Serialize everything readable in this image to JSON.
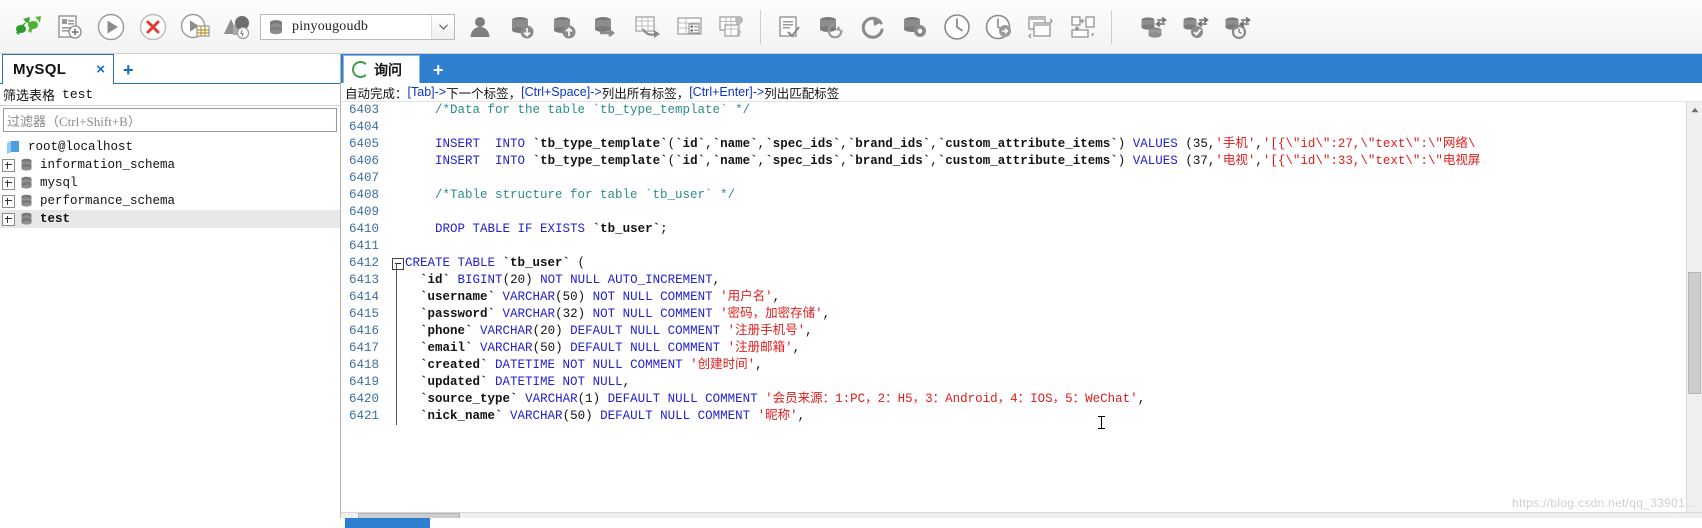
{
  "toolbar": {
    "icons": [
      {
        "name": "connect-icon",
        "title": "Connect"
      },
      {
        "name": "new-query-icon",
        "title": "New Query"
      },
      {
        "name": "execute-icon",
        "title": "Execute"
      },
      {
        "name": "stop-icon",
        "title": "Stop"
      },
      {
        "name": "execute-to-grid-icon",
        "title": "Execute to Grid"
      },
      {
        "name": "explain-plan-icon",
        "title": "Explain Plan"
      }
    ],
    "db_selector": {
      "name": "pinyougoudb",
      "icon": "database-icon",
      "arrow": "chevron-down-icon"
    },
    "icons_group2": [
      {
        "name": "user-manager-icon",
        "title": "User Manager"
      },
      {
        "name": "backup-database-icon",
        "title": "Backup Database"
      },
      {
        "name": "restore-database-icon",
        "title": "Restore Database"
      },
      {
        "name": "transfer-database-icon",
        "title": "Transfer Database"
      },
      {
        "name": "export-table-icon",
        "title": "Export Table"
      },
      {
        "name": "table-data-icon",
        "title": "Table Data"
      },
      {
        "name": "table-design-icon",
        "title": "Table Design"
      }
    ],
    "icons_group3": [
      {
        "name": "query-builder-icon",
        "title": "Query Builder"
      },
      {
        "name": "refresh-database-icon",
        "title": "Refresh Database"
      },
      {
        "name": "refresh-icon",
        "title": "Refresh"
      },
      {
        "name": "database-settings-icon",
        "title": "Database Settings"
      },
      {
        "name": "history-icon",
        "title": "History"
      },
      {
        "name": "scheduled-job-icon",
        "title": "Scheduled Job"
      },
      {
        "name": "window-tile-icon",
        "title": "Tile Windows"
      },
      {
        "name": "window-arrange-icon",
        "title": "Arrange Windows"
      }
    ],
    "icons_group4": [
      {
        "name": "data-sync-icon",
        "title": "Data Synchronization"
      },
      {
        "name": "data-sync-check-icon",
        "title": "Structure Synchronization"
      },
      {
        "name": "data-sync-history-icon",
        "title": "Synchronization History"
      }
    ]
  },
  "sidebar": {
    "connection_tab": {
      "label": "MySQL",
      "close": "×"
    },
    "add_tab": "+",
    "filter": {
      "label": "筛选表格",
      "value": "test",
      "placeholder": "过滤器（Ctrl+Shift+B）"
    },
    "tree": [
      {
        "label": "root@localhost",
        "icon": "server-icon",
        "expandable": false,
        "bold": false,
        "selected": false,
        "indent": 0
      },
      {
        "label": "information_schema",
        "icon": "database-icon",
        "expandable": true,
        "bold": false,
        "selected": false,
        "indent": 1
      },
      {
        "label": "mysql",
        "icon": "database-icon",
        "expandable": true,
        "bold": false,
        "selected": false,
        "indent": 1
      },
      {
        "label": "performance_schema",
        "icon": "database-icon",
        "expandable": true,
        "bold": false,
        "selected": false,
        "indent": 1
      },
      {
        "label": "test",
        "icon": "database-icon",
        "expandable": true,
        "bold": true,
        "selected": true,
        "indent": 1
      }
    ]
  },
  "query_panel": {
    "tab": {
      "label": "询问",
      "icon": "query-spinner-icon"
    },
    "add_tab": "+",
    "hint": {
      "prefix": "自动完成：",
      "part1_key": "[Tab]->",
      "part1_text": " 下一个标签，",
      "part2_key": "[Ctrl+Space]->",
      "part2_text": " 列出所有标签，",
      "part3_key": "[Ctrl+Enter]->",
      "part3_text": " 列出匹配标签"
    },
    "first_line_number": 6403,
    "lines": [
      {
        "n": "6403",
        "fold": "none",
        "tokens": [
          {
            "t": "    ",
            "c": "plain"
          },
          {
            "t": "/*Data for the table `tb_type_template` */",
            "c": "cmt"
          }
        ]
      },
      {
        "n": "6404",
        "fold": "none",
        "tokens": []
      },
      {
        "n": "6405",
        "fold": "none",
        "tokens": [
          {
            "t": "    ",
            "c": "plain"
          },
          {
            "t": "INSERT",
            "c": "kw"
          },
          {
            "t": "  ",
            "c": "plain"
          },
          {
            "t": "INTO",
            "c": "kw"
          },
          {
            "t": " ",
            "c": "plain"
          },
          {
            "t": "`tb_type_template`",
            "c": "ident"
          },
          {
            "t": "(",
            "c": "pun"
          },
          {
            "t": "`id`",
            "c": "ident"
          },
          {
            "t": ",",
            "c": "pun"
          },
          {
            "t": "`name`",
            "c": "ident"
          },
          {
            "t": ",",
            "c": "pun"
          },
          {
            "t": "`spec_ids`",
            "c": "ident"
          },
          {
            "t": ",",
            "c": "pun"
          },
          {
            "t": "`brand_ids`",
            "c": "ident"
          },
          {
            "t": ",",
            "c": "pun"
          },
          {
            "t": "`custom_attribute_items`",
            "c": "ident"
          },
          {
            "t": ") ",
            "c": "pun"
          },
          {
            "t": "VALUES",
            "c": "kw"
          },
          {
            "t": " (35,",
            "c": "plain"
          },
          {
            "t": "'手机'",
            "c": "str"
          },
          {
            "t": ",",
            "c": "plain"
          },
          {
            "t": "'[{\\\"id\\\":27,\\\"text\\\":\\\"网络\\",
            "c": "str"
          }
        ]
      },
      {
        "n": "6406",
        "fold": "none",
        "tokens": [
          {
            "t": "    ",
            "c": "plain"
          },
          {
            "t": "INSERT",
            "c": "kw"
          },
          {
            "t": "  ",
            "c": "plain"
          },
          {
            "t": "INTO",
            "c": "kw"
          },
          {
            "t": " ",
            "c": "plain"
          },
          {
            "t": "`tb_type_template`",
            "c": "ident"
          },
          {
            "t": "(",
            "c": "pun"
          },
          {
            "t": "`id`",
            "c": "ident"
          },
          {
            "t": ",",
            "c": "pun"
          },
          {
            "t": "`name`",
            "c": "ident"
          },
          {
            "t": ",",
            "c": "pun"
          },
          {
            "t": "`spec_ids`",
            "c": "ident"
          },
          {
            "t": ",",
            "c": "pun"
          },
          {
            "t": "`brand_ids`",
            "c": "ident"
          },
          {
            "t": ",",
            "c": "pun"
          },
          {
            "t": "`custom_attribute_items`",
            "c": "ident"
          },
          {
            "t": ") ",
            "c": "pun"
          },
          {
            "t": "VALUES",
            "c": "kw"
          },
          {
            "t": " (37,",
            "c": "plain"
          },
          {
            "t": "'电视'",
            "c": "str"
          },
          {
            "t": ",",
            "c": "plain"
          },
          {
            "t": "'[{\\\"id\\\":33,\\\"text\\\":\\\"电视屏",
            "c": "str"
          }
        ]
      },
      {
        "n": "6407",
        "fold": "none",
        "tokens": []
      },
      {
        "n": "6408",
        "fold": "none",
        "tokens": [
          {
            "t": "    ",
            "c": "plain"
          },
          {
            "t": "/*Table structure for table `tb_user` */",
            "c": "cmt"
          }
        ]
      },
      {
        "n": "6409",
        "fold": "none",
        "tokens": []
      },
      {
        "n": "6410",
        "fold": "none",
        "tokens": [
          {
            "t": "    ",
            "c": "plain"
          },
          {
            "t": "DROP TABLE IF EXISTS",
            "c": "kw"
          },
          {
            "t": " ",
            "c": "plain"
          },
          {
            "t": "`tb_user`",
            "c": "ident"
          },
          {
            "t": ";",
            "c": "pun"
          }
        ]
      },
      {
        "n": "6411",
        "fold": "none",
        "tokens": []
      },
      {
        "n": "6412",
        "fold": "start",
        "tokens": [
          {
            "t": "CREATE TABLE",
            "c": "kw"
          },
          {
            "t": " ",
            "c": "plain"
          },
          {
            "t": "`tb_user`",
            "c": "ident"
          },
          {
            "t": " (",
            "c": "pun"
          }
        ]
      },
      {
        "n": "6413",
        "fold": "line",
        "tokens": [
          {
            "t": "  ",
            "c": "plain"
          },
          {
            "t": "`id`",
            "c": "ident"
          },
          {
            "t": " ",
            "c": "plain"
          },
          {
            "t": "BIGINT",
            "c": "kw"
          },
          {
            "t": "(20) ",
            "c": "plain"
          },
          {
            "t": "NOT NULL AUTO_INCREMENT",
            "c": "kw"
          },
          {
            "t": ",",
            "c": "pun"
          }
        ]
      },
      {
        "n": "6414",
        "fold": "line",
        "tokens": [
          {
            "t": "  ",
            "c": "plain"
          },
          {
            "t": "`username`",
            "c": "ident"
          },
          {
            "t": " ",
            "c": "plain"
          },
          {
            "t": "VARCHAR",
            "c": "kw"
          },
          {
            "t": "(50) ",
            "c": "plain"
          },
          {
            "t": "NOT NULL COMMENT",
            "c": "kw"
          },
          {
            "t": " ",
            "c": "plain"
          },
          {
            "t": "'用户名'",
            "c": "str"
          },
          {
            "t": ",",
            "c": "pun"
          }
        ]
      },
      {
        "n": "6415",
        "fold": "line",
        "tokens": [
          {
            "t": "  ",
            "c": "plain"
          },
          {
            "t": "`password`",
            "c": "ident"
          },
          {
            "t": " ",
            "c": "plain"
          },
          {
            "t": "VARCHAR",
            "c": "kw"
          },
          {
            "t": "(32) ",
            "c": "plain"
          },
          {
            "t": "NOT NULL COMMENT",
            "c": "kw"
          },
          {
            "t": " ",
            "c": "plain"
          },
          {
            "t": "'密码，加密存储'",
            "c": "str"
          },
          {
            "t": ",",
            "c": "pun"
          }
        ]
      },
      {
        "n": "6416",
        "fold": "line",
        "tokens": [
          {
            "t": "  ",
            "c": "plain"
          },
          {
            "t": "`phone`",
            "c": "ident"
          },
          {
            "t": " ",
            "c": "plain"
          },
          {
            "t": "VARCHAR",
            "c": "kw"
          },
          {
            "t": "(20) ",
            "c": "plain"
          },
          {
            "t": "DEFAULT NULL COMMENT",
            "c": "kw"
          },
          {
            "t": " ",
            "c": "plain"
          },
          {
            "t": "'注册手机号'",
            "c": "str"
          },
          {
            "t": ",",
            "c": "pun"
          }
        ]
      },
      {
        "n": "6417",
        "fold": "line",
        "tokens": [
          {
            "t": "  ",
            "c": "plain"
          },
          {
            "t": "`email`",
            "c": "ident"
          },
          {
            "t": " ",
            "c": "plain"
          },
          {
            "t": "VARCHAR",
            "c": "kw"
          },
          {
            "t": "(50) ",
            "c": "plain"
          },
          {
            "t": "DEFAULT NULL COMMENT",
            "c": "kw"
          },
          {
            "t": " ",
            "c": "plain"
          },
          {
            "t": "'注册邮箱'",
            "c": "str"
          },
          {
            "t": ",",
            "c": "pun"
          }
        ]
      },
      {
        "n": "6418",
        "fold": "line",
        "tokens": [
          {
            "t": "  ",
            "c": "plain"
          },
          {
            "t": "`created`",
            "c": "ident"
          },
          {
            "t": " ",
            "c": "plain"
          },
          {
            "t": "DATETIME NOT NULL COMMENT",
            "c": "kw"
          },
          {
            "t": " ",
            "c": "plain"
          },
          {
            "t": "'创建时间'",
            "c": "str"
          },
          {
            "t": ",",
            "c": "pun"
          }
        ]
      },
      {
        "n": "6419",
        "fold": "line",
        "tokens": [
          {
            "t": "  ",
            "c": "plain"
          },
          {
            "t": "`updated`",
            "c": "ident"
          },
          {
            "t": " ",
            "c": "plain"
          },
          {
            "t": "DATETIME NOT NULL",
            "c": "kw"
          },
          {
            "t": ",",
            "c": "pun"
          }
        ]
      },
      {
        "n": "6420",
        "fold": "line",
        "tokens": [
          {
            "t": "  ",
            "c": "plain"
          },
          {
            "t": "`source_type`",
            "c": "ident"
          },
          {
            "t": " ",
            "c": "plain"
          },
          {
            "t": "VARCHAR",
            "c": "kw"
          },
          {
            "t": "(1) ",
            "c": "plain"
          },
          {
            "t": "DEFAULT NULL COMMENT",
            "c": "kw"
          },
          {
            "t": " ",
            "c": "plain"
          },
          {
            "t": "'会员来源：1:PC，2：H5，3：Android，4：IOS，5：WeChat'",
            "c": "str"
          },
          {
            "t": ",",
            "c": "pun"
          }
        ]
      },
      {
        "n": "6421",
        "fold": "line",
        "tokens": [
          {
            "t": "  ",
            "c": "plain"
          },
          {
            "t": "`nick_name`",
            "c": "ident"
          },
          {
            "t": " ",
            "c": "plain"
          },
          {
            "t": "VARCHAR",
            "c": "kw"
          },
          {
            "t": "(50) ",
            "c": "plain"
          },
          {
            "t": "DEFAULT NULL COMMENT",
            "c": "kw"
          },
          {
            "t": " ",
            "c": "plain"
          },
          {
            "t": "'昵称'",
            "c": "str"
          },
          {
            "t": ",",
            "c": "pun"
          }
        ]
      }
    ],
    "watermark": "https://blog.csdn.net/qq_33901..."
  },
  "colors": {
    "tab_active_blue": "#2f7fd1",
    "keyword_blue": "#2222cc",
    "string_red": "#e01b1b",
    "comment_teal": "#2e8b8b",
    "gutter_blue": "#3b6ea5",
    "toolbar_gray": "#8a8a8a"
  }
}
